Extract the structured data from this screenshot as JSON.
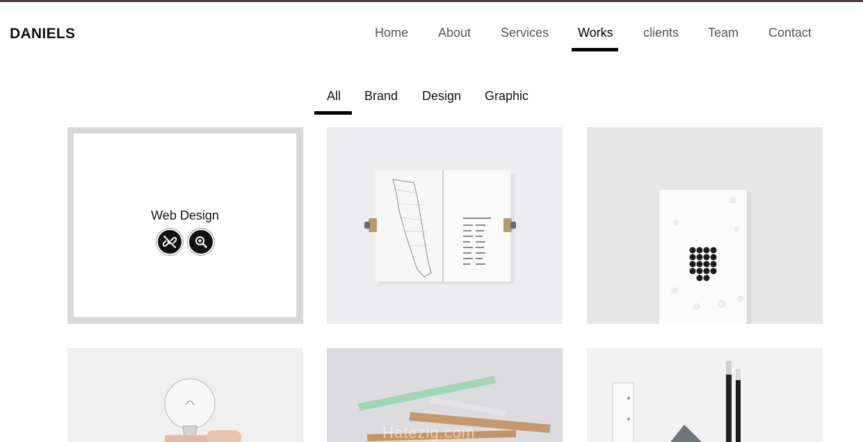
{
  "header": {
    "brand": "DANIELS",
    "nav": [
      {
        "label": "Home"
      },
      {
        "label": "About"
      },
      {
        "label": "Services"
      },
      {
        "label": "Works",
        "active": true
      },
      {
        "label": "clients"
      },
      {
        "label": "Team"
      },
      {
        "label": "Contact"
      }
    ]
  },
  "works": {
    "filters": [
      {
        "label": "All",
        "active": true
      },
      {
        "label": "Brand"
      },
      {
        "label": "Design"
      },
      {
        "label": "Graphic"
      }
    ],
    "items": [
      {
        "title": "Web Design",
        "hovered": true,
        "link_icon": "unlink-icon",
        "zoom_icon": "zoom-in-icon"
      },
      {
        "image": "open-notebook-map"
      },
      {
        "image": "white-card-dots"
      },
      {
        "image": "lightbulb-hand"
      },
      {
        "image": "colored-pencils"
      },
      {
        "image": "stationery-pens"
      }
    ]
  },
  "watermark": "Hatezig.com",
  "colors": {
    "accent": "#000000",
    "top_border": "#4a3a40",
    "nav_text": "#555555"
  }
}
